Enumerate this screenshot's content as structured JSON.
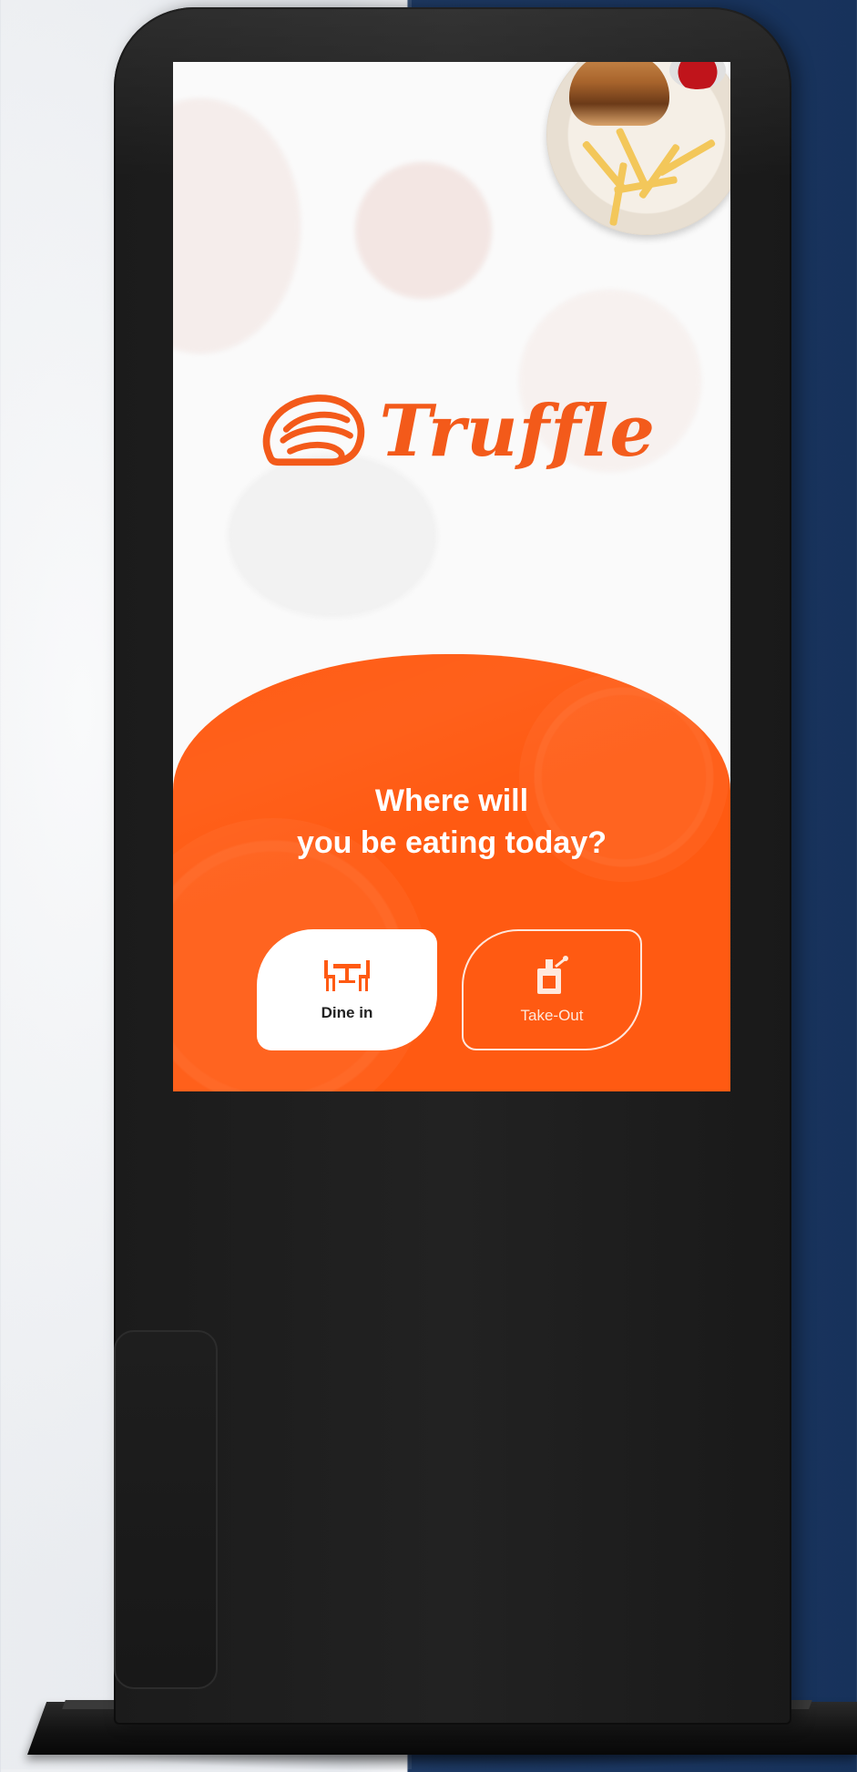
{
  "brand": {
    "name": "Truffle",
    "accent": "#ff5a12",
    "logo_color": "#f35a1a"
  },
  "prompt": {
    "line1": "Where will",
    "line2": "you be eating today?"
  },
  "options": [
    {
      "label": "Dine in",
      "icon": "dining-table-icon",
      "selected": true
    },
    {
      "label": "Take-Out",
      "icon": "takeout-bag-icon",
      "selected": false
    }
  ]
}
